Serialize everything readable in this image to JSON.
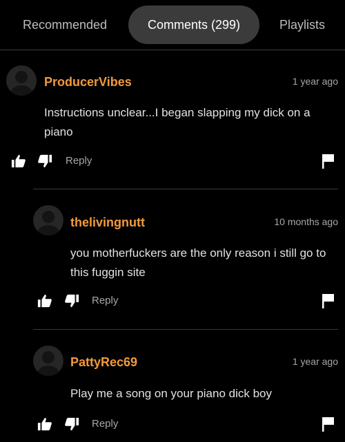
{
  "tabs": [
    {
      "label": "Recommended"
    },
    {
      "label": "Comments (299)"
    },
    {
      "label": "Playlists"
    }
  ],
  "comments": [
    {
      "username": "ProducerVibes",
      "time": "1 year ago",
      "text": "Instructions unclear...I began slapping my dick on a piano",
      "reply_label": "Reply"
    },
    {
      "username": "thelivingnutt",
      "time": "10 months ago",
      "text": "you motherfuckers are the only reason i still go to this fuggin site",
      "reply_label": "Reply"
    },
    {
      "username": "PattyRec69",
      "time": "1 year ago",
      "text": "Play me a song on your piano dick boy",
      "reply_label": "Reply"
    }
  ],
  "colors": {
    "background": "#000000",
    "username": "#f39a3c",
    "active_tab": "#3b3b3b"
  }
}
